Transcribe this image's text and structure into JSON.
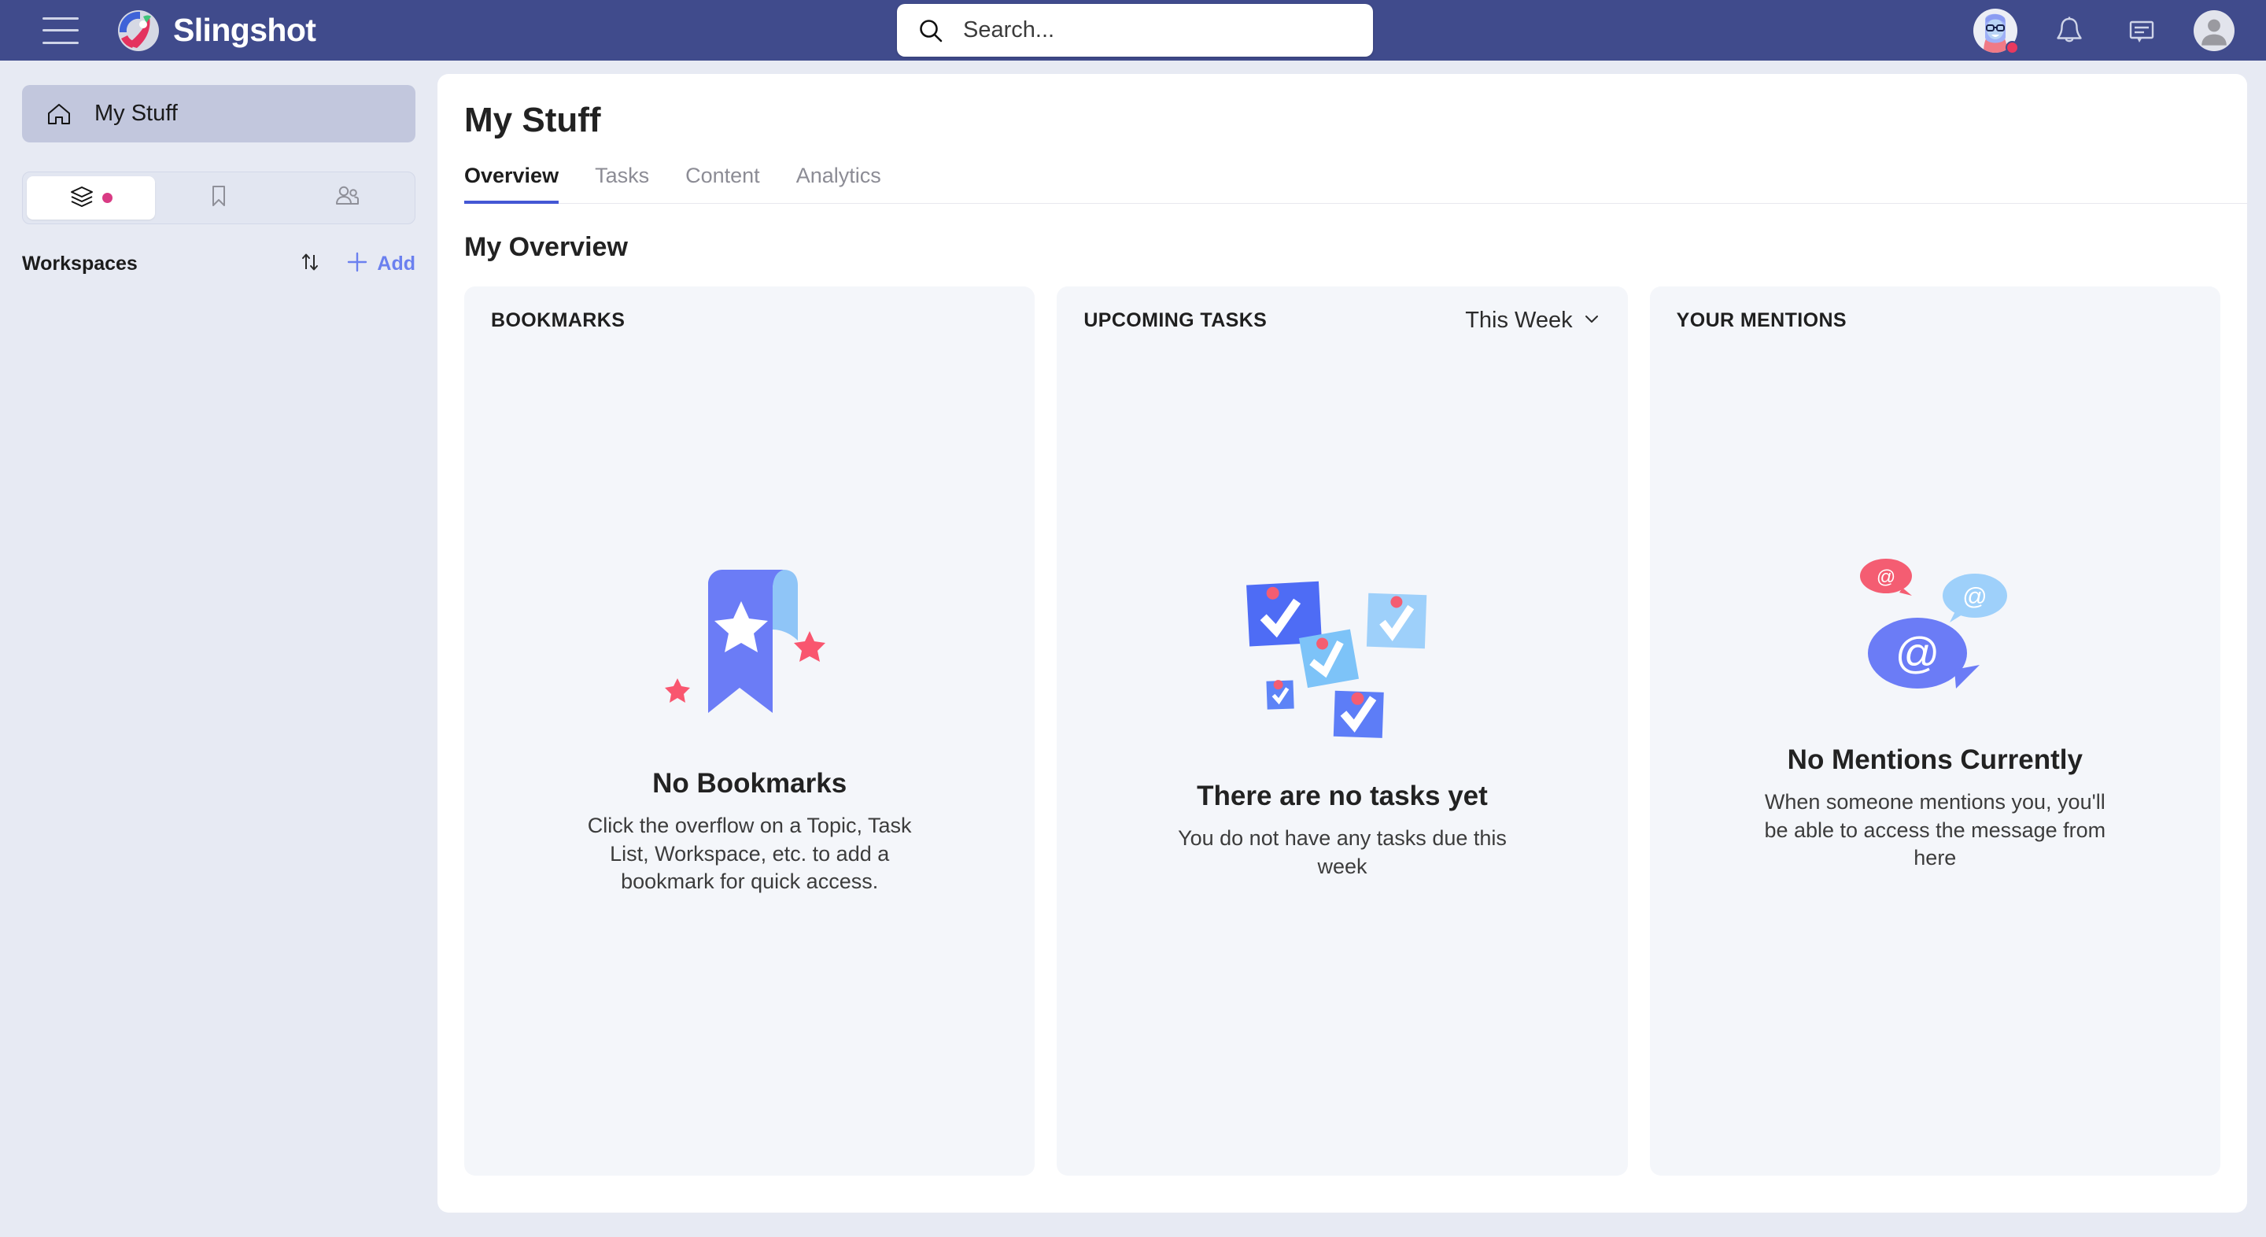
{
  "app": {
    "brand_name": "Slingshot",
    "menu_icon": "hamburger-menu-icon",
    "logo_icon": "slingshot-rocket-logo"
  },
  "search": {
    "placeholder": "Search...",
    "value": "",
    "icon": "search-icon"
  },
  "topbar_actions": [
    {
      "name": "user-avatar-badge",
      "icon": "avatar-icon",
      "badge": true
    },
    {
      "name": "notifications",
      "icon": "bell-icon"
    },
    {
      "name": "messages",
      "icon": "chat-bubble-icon"
    },
    {
      "name": "profile",
      "icon": "profile-avatar-icon"
    }
  ],
  "sidebar": {
    "my_stuff": {
      "label": "My Stuff",
      "icon": "home-icon",
      "active": true
    },
    "segmented_tabs": [
      {
        "name": "workspaces-tab",
        "icon": "layers-icon",
        "active": true,
        "dot": true
      },
      {
        "name": "bookmarks-tab",
        "icon": "bookmark-icon",
        "active": false,
        "dot": false
      },
      {
        "name": "people-tab",
        "icon": "people-icon",
        "active": false,
        "dot": false
      }
    ],
    "workspaces": {
      "title": "Workspaces",
      "sort_icon": "sort-arrows-icon",
      "add_icon": "plus-icon",
      "add_label": "Add"
    }
  },
  "main": {
    "page_title": "My Stuff",
    "tabs": [
      {
        "label": "Overview",
        "active": true
      },
      {
        "label": "Tasks",
        "active": false
      },
      {
        "label": "Content",
        "active": false
      },
      {
        "label": "Analytics",
        "active": false
      }
    ],
    "overview_title": "My Overview",
    "cards": [
      {
        "header": "BOOKMARKS",
        "filter": null,
        "empty_title": "No Bookmarks",
        "empty_sub": "Click the overflow on a Topic, Task List, Workspace, etc. to add a bookmark for quick access.",
        "illustration": "bookmark-ribbon-illustration"
      },
      {
        "header": "UPCOMING TASKS",
        "filter": {
          "label": "This Week",
          "icon": "chevron-down-icon"
        },
        "empty_title": "There are no tasks yet",
        "empty_sub": "You do not have any tasks due this week",
        "illustration": "sticky-notes-checkmarks-illustration"
      },
      {
        "header": "YOUR MENTIONS",
        "filter": null,
        "empty_title": "No Mentions Currently",
        "empty_sub": "When someone mentions you, you'll be able to access the message from here",
        "illustration": "at-mention-bubbles-illustration"
      }
    ]
  },
  "colors": {
    "topbar": "#404b8c",
    "sidebar": "#e7eaf3",
    "panel": "#ffffff",
    "card": "#f4f6fa",
    "accent_blue": "#6b80ef",
    "tab_underline": "#4457d4",
    "badge_pink": "#d93b84",
    "illustration_blue": "#6b7cf6",
    "illustration_lightblue": "#8fc5f7",
    "illustration_pink": "#f9566f"
  }
}
